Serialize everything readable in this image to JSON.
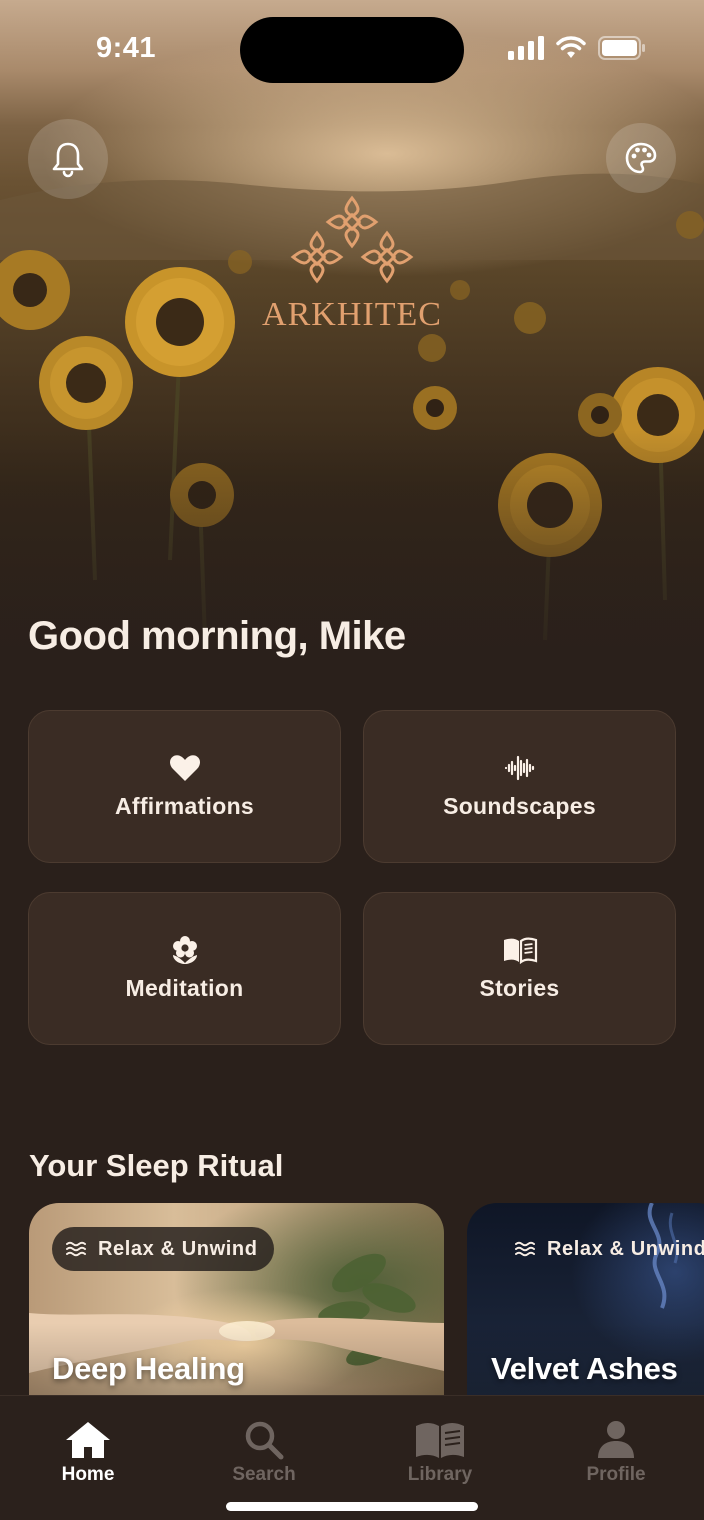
{
  "status_bar": {
    "time": "9:41"
  },
  "header": {
    "notifications_icon": "bell-icon",
    "theme_icon": "palette-icon",
    "logo_text": "ARKHITEC"
  },
  "greeting": "Good morning, Mike",
  "categories": [
    {
      "label": "Affirmations",
      "icon": "heart-icon"
    },
    {
      "label": "Soundscapes",
      "icon": "waveform-icon"
    },
    {
      "label": "Meditation",
      "icon": "flower-icon"
    },
    {
      "label": "Stories",
      "icon": "book-icon"
    }
  ],
  "sleep_ritual": {
    "title": "Your Sleep Ritual",
    "cards": [
      {
        "tag": "Relax & Unwind",
        "title": "Deep Healing"
      },
      {
        "tag": "Relax & Unwind",
        "title": "Velvet Ashes"
      }
    ]
  },
  "tabbar": {
    "items": [
      {
        "label": "Home",
        "icon": "home-icon",
        "active": true
      },
      {
        "label": "Search",
        "icon": "search-icon",
        "active": false
      },
      {
        "label": "Library",
        "icon": "library-icon",
        "active": false
      },
      {
        "label": "Profile",
        "icon": "profile-icon",
        "active": false
      }
    ]
  },
  "colors": {
    "background": "#2a201b",
    "tile": "#3a2c24",
    "accent_logo": "#e1a06f",
    "text": "#f7ede4",
    "tab_inactive": "#6f6560"
  }
}
